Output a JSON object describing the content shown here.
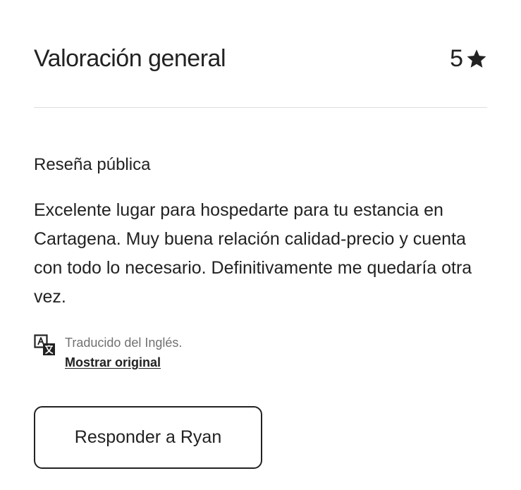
{
  "overall": {
    "title": "Valoración general",
    "rating": "5",
    "rating_icon": "star-icon"
  },
  "public_review": {
    "title": "Reseña pública",
    "text": "Excelente lugar para hospedarte para tu estancia en Cartagena. Muy buena relación calidad-precio y cuenta con todo lo necesario. Definitivamente me quedaría otra vez."
  },
  "translation": {
    "icon": "translate-icon",
    "translated_from": "Traducido del Inglés.",
    "show_original_label": "Mostrar original"
  },
  "actions": {
    "reply_label": "Responder a Ryan"
  },
  "colors": {
    "text": "#222222",
    "muted": "#717171",
    "divider": "#dddddd"
  }
}
